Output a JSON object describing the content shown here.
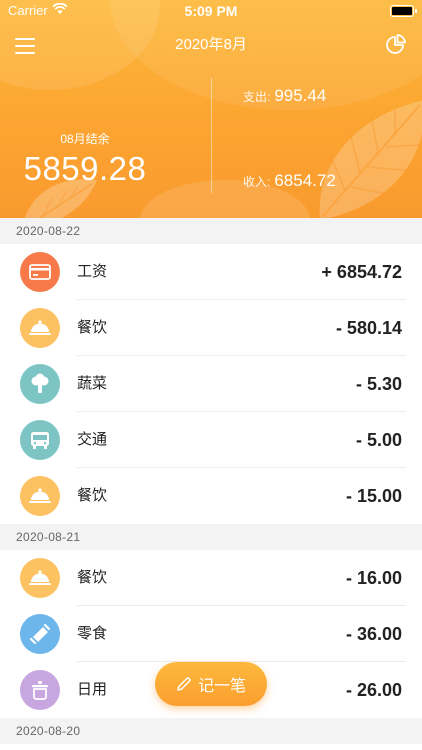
{
  "status_bar": {
    "carrier": "Carrier",
    "time": "5:09 PM"
  },
  "header": {
    "title": "2020年8月",
    "balance_label": "08月结余",
    "balance_value": "5859.28",
    "expense_label": "支出:",
    "expense_value": "995.44",
    "income_label": "收入:",
    "income_value": "6854.72"
  },
  "icons": {
    "menu": "menu-icon",
    "chart": "pie-chart-icon",
    "salary": "card-icon",
    "dining": "cloche-icon",
    "vegetable": "broccoli-icon",
    "transport": "bus-icon",
    "snack": "snack-icon",
    "daily": "pot-icon",
    "add": "pencil-icon"
  },
  "colors": {
    "accent": "#fca531",
    "salary": "#f8794a",
    "dining": "#fcc262",
    "vegetable": "#7cc5c4",
    "transport": "#7cc5c4",
    "snack": "#6cb6ec",
    "daily": "#c8a6e0"
  },
  "groups": [
    {
      "date": "2020-08-22",
      "items": [
        {
          "category": "工资",
          "amount": "+ 6854.72",
          "kind": "salary"
        },
        {
          "category": "餐饮",
          "amount": "- 580.14",
          "kind": "dining"
        },
        {
          "category": "蔬菜",
          "amount": "- 5.30",
          "kind": "vegetable"
        },
        {
          "category": "交通",
          "amount": "- 5.00",
          "kind": "transport"
        },
        {
          "category": "餐饮",
          "amount": "- 15.00",
          "kind": "dining"
        }
      ]
    },
    {
      "date": "2020-08-21",
      "items": [
        {
          "category": "餐饮",
          "amount": "- 16.00",
          "kind": "dining"
        },
        {
          "category": "零食",
          "amount": "- 36.00",
          "kind": "snack"
        },
        {
          "category": "日用",
          "amount": "- 26.00",
          "kind": "daily"
        }
      ]
    },
    {
      "date": "2020-08-20",
      "items": []
    }
  ],
  "fab_label": "记一笔"
}
